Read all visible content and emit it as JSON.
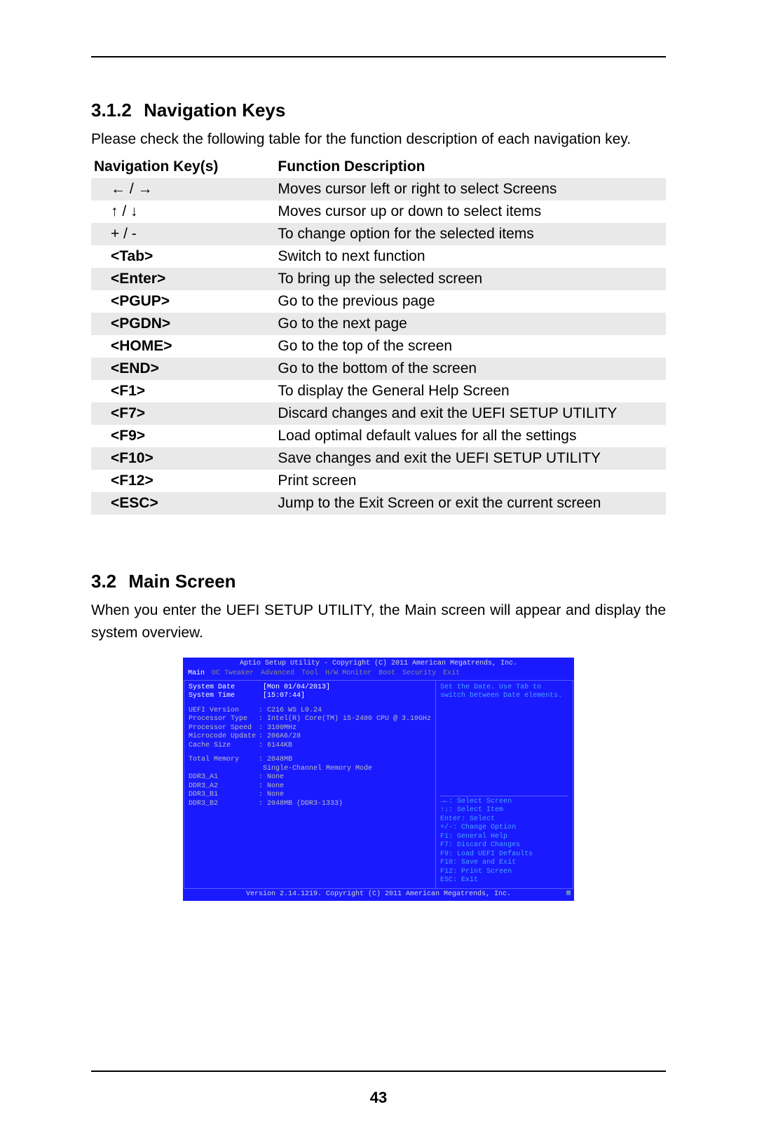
{
  "page_number": "43",
  "section1": {
    "number": "3.1.2",
    "title": "Navigation Keys",
    "intro": "Please check the following table for the function description of each navigation key.",
    "table_headers": {
      "keys": "Navigation Key(s)",
      "desc": "Function Description"
    },
    "rows": [
      {
        "key": "← / →",
        "key_is_symbol": true,
        "desc": "Moves cursor left or right to select Screens"
      },
      {
        "key": "↑ / ↓",
        "key_is_symbol": true,
        "desc": "Moves cursor up or down to select items"
      },
      {
        "key": "+  /  -",
        "key_is_symbol": true,
        "desc": "To change option for the selected items"
      },
      {
        "key": "<Tab>",
        "desc": "Switch to next function"
      },
      {
        "key": "<Enter>",
        "desc": "To bring up the selected screen"
      },
      {
        "key": "<PGUP>",
        "desc": "Go to the previous page"
      },
      {
        "key": "<PGDN>",
        "desc": "Go to the next page"
      },
      {
        "key": "<HOME>",
        "desc": "Go to the top of the screen"
      },
      {
        "key": "<END>",
        "desc": "Go to the bottom of the screen"
      },
      {
        "key": "<F1>",
        "desc": "To display the General Help Screen"
      },
      {
        "key": "<F7>",
        "desc": "Discard changes and exit the UEFI SETUP UTILITY"
      },
      {
        "key": "<F9>",
        "desc": "Load optimal default values for all the settings"
      },
      {
        "key": "<F10>",
        "desc": "Save changes and exit the UEFI SETUP UTILITY"
      },
      {
        "key": "<F12>",
        "desc": "Print screen"
      },
      {
        "key": "<ESC>",
        "desc": "Jump to the Exit Screen or exit the current screen"
      }
    ]
  },
  "section2": {
    "number": "3.2",
    "title": "Main Screen",
    "intro": "When you enter the UEFI SETUP UTILITY, the Main screen will appear and display the system overview."
  },
  "bios": {
    "top": "Aptio Setup Utility - Copyright (C) 2011 American Megatrends, Inc.",
    "menu": [
      "Main",
      "OC Tweaker",
      "Advanced",
      "Tool",
      "H/W Monitor",
      "Boot",
      "Security",
      "Exit"
    ],
    "menu_active": "Main",
    "left": {
      "system_date": {
        "label": "System Date",
        "value": "[Mon 01/04/2013]"
      },
      "system_time": {
        "label": "System Time",
        "value": "[15:07:44]"
      },
      "info": [
        {
          "label": "UEFI Version",
          "value": ": C216 WS L0.24"
        },
        {
          "label": "Processor Type",
          "value": ": Intel(R) Core(TM) i5-2400 CPU @ 3.10GHz"
        },
        {
          "label": "Processor Speed",
          "value": ": 3100MHz"
        },
        {
          "label": "Microcode Update",
          "value": ": 206A6/28"
        },
        {
          "label": "Cache Size",
          "value": ": 6144KB"
        }
      ],
      "mem": [
        {
          "label": "Total Memory",
          "value": ": 2048MB"
        },
        {
          "label": "",
          "value": "  Single-Channel Memory Mode"
        },
        {
          "label": "DDR3_A1",
          "value": ": None"
        },
        {
          "label": "DDR3_A2",
          "value": ": None"
        },
        {
          "label": "DDR3_B1",
          "value": ": None"
        },
        {
          "label": "DDR3_B2",
          "value": ": 2048MB (DDR3-1333)"
        }
      ]
    },
    "right": {
      "help1": "Set the Date. Use Tab to",
      "help2": "switch between Date elements.",
      "nav": [
        "→←: Select Screen",
        "↑↓: Select Item",
        "Enter: Select",
        "+/-: Change Option",
        "F1: General Help",
        "F7: Discard Changes",
        "F9: Load UEFI Defaults",
        "F10: Save and Exit",
        "F12: Print Screen",
        "ESC: Exit"
      ]
    },
    "footer": "Version 2.14.1219. Copyright (C) 2011 American Megatrends, Inc."
  }
}
